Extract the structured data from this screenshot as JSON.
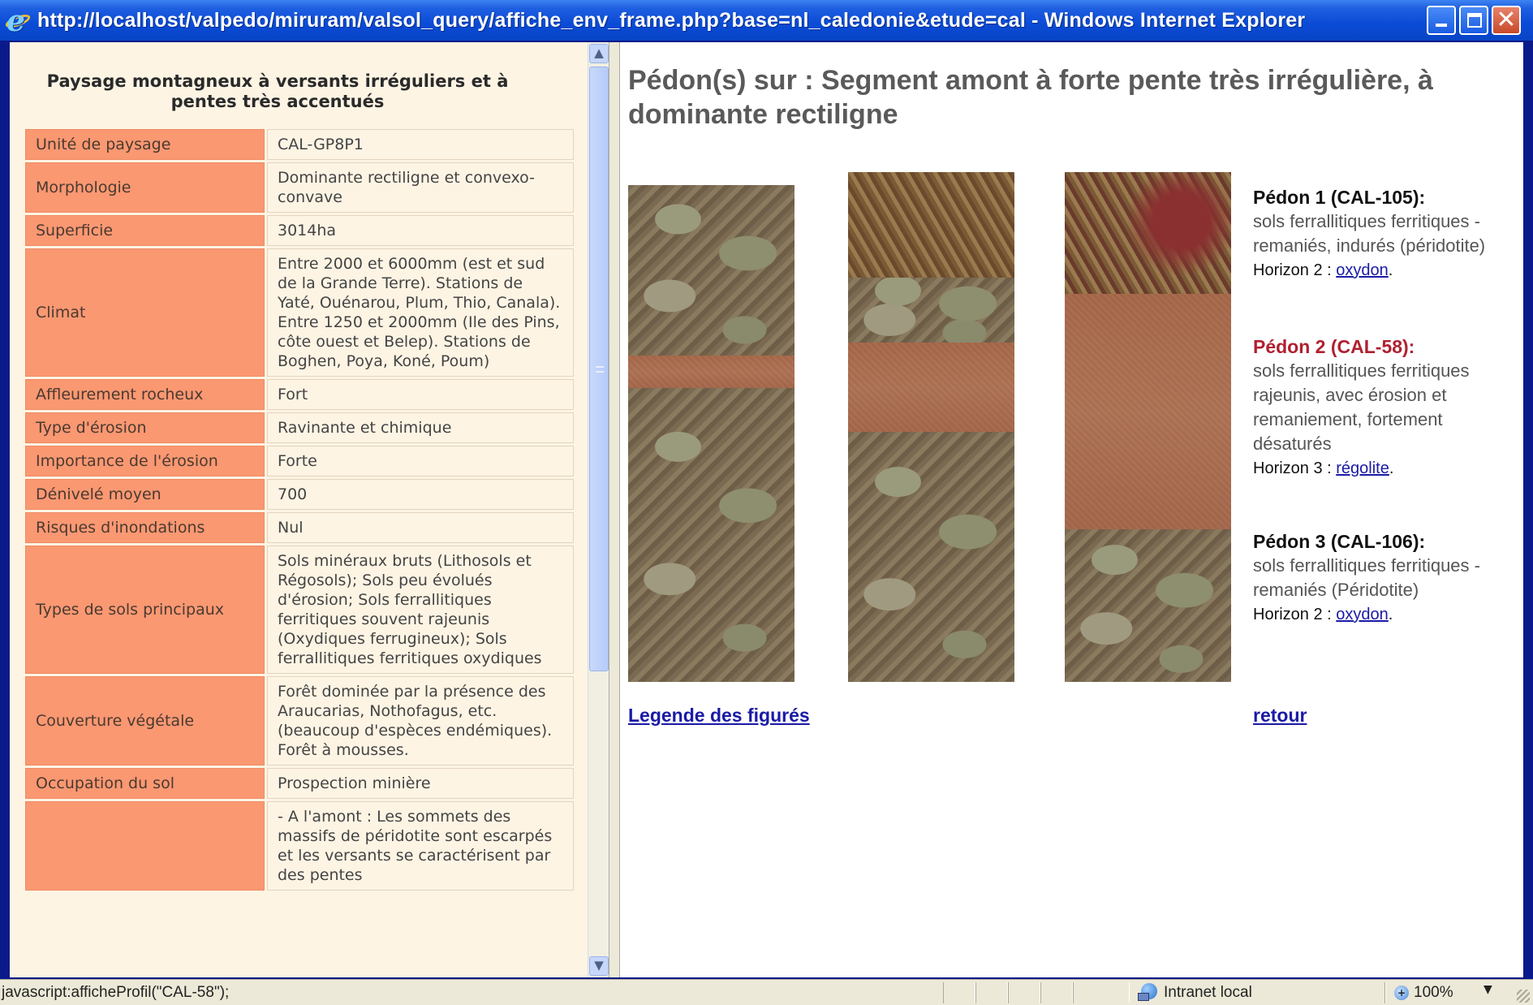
{
  "window": {
    "title": "http://localhost/valpedo/miruram/valsol_query/affiche_env_frame.php?base=nl_caledonie&etude=cal - Windows Internet Explorer"
  },
  "left": {
    "heading": "Paysage montagneux à versants irréguliers et à pentes très accentués",
    "rows": [
      {
        "label": "Unité de paysage",
        "value": "CAL-GP8P1"
      },
      {
        "label": "Morphologie",
        "value": "Dominante rectiligne et convexo-convave"
      },
      {
        "label": "Superficie",
        "value": "3014ha"
      },
      {
        "label": "Climat",
        "value": "Entre 2000 et 6000mm (est et sud de la Grande Terre). Stations de Yaté, Ouénarou, Plum, Thio, Canala). Entre 1250 et 2000mm (Ile des Pins, côte ouest et Belep). Stations de Boghen, Poya, Koné, Poum)"
      },
      {
        "label": "Affleurement rocheux",
        "value": "Fort"
      },
      {
        "label": "Type d'érosion",
        "value": "Ravinante et chimique"
      },
      {
        "label": "Importance de l'érosion",
        "value": "Forte"
      },
      {
        "label": "Dénivelé moyen",
        "value": "700"
      },
      {
        "label": "Risques d'inondations",
        "value": "Nul"
      },
      {
        "label": "Types de sols principaux",
        "value": "Sols minéraux bruts (Lithosols et Régosols); Sols peu évolués d'érosion; Sols ferrallitiques ferritiques souvent rajeunis (Oxydiques ferrugineux); Sols ferrallitiques ferritiques oxydiques"
      },
      {
        "label": "Couverture végétale",
        "value": "Forêt dominée par la présence des Araucarias, Nothofagus, etc. (beaucoup d'espèces endémiques). Forêt à mousses."
      },
      {
        "label": "Occupation du sol",
        "value": "Prospection minière"
      },
      {
        "label": "",
        "value": "- A l'amont : Les sommets des massifs de péridotite sont escarpés et les versants se caractérisent par des pentes"
      }
    ]
  },
  "right": {
    "title": "Pédon(s) sur : Segment amont à forte pente très irrégulière, à dominante rectiligne",
    "pedons": [
      {
        "title": "Pédon 1 (CAL-105):",
        "desc": "sols ferrallitiques ferritiques - remaniés, indurés (péridotite)",
        "horizon_prefix": "Horizon 2 : ",
        "horizon_link": "oxydon",
        "horizon_suffix": "."
      },
      {
        "title": "Pédon 2 (CAL-58):",
        "desc": "sols ferrallitiques ferritiques rajeunis, avec érosion et remaniement, fortement désaturés",
        "horizon_prefix": "Horizon 3 : ",
        "horizon_link": "régolite",
        "horizon_suffix": "."
      },
      {
        "title": "Pédon 3 (CAL-106):",
        "desc": "sols ferrallitiques ferritiques - remaniés (Péridotite)",
        "horizon_prefix": "Horizon 2 : ",
        "horizon_link": "oxydon",
        "horizon_suffix": "."
      }
    ],
    "legend_link": "Legende des figurés",
    "back_link": "retour"
  },
  "status": {
    "text": "javascript:afficheProfil(\"CAL-58\");",
    "zone": "Intranet local",
    "zoom": "100%"
  },
  "icons": {
    "browser": "internet-explorer-icon",
    "zone": "intranet-zone-icon",
    "zoom": "zoom-icon"
  }
}
